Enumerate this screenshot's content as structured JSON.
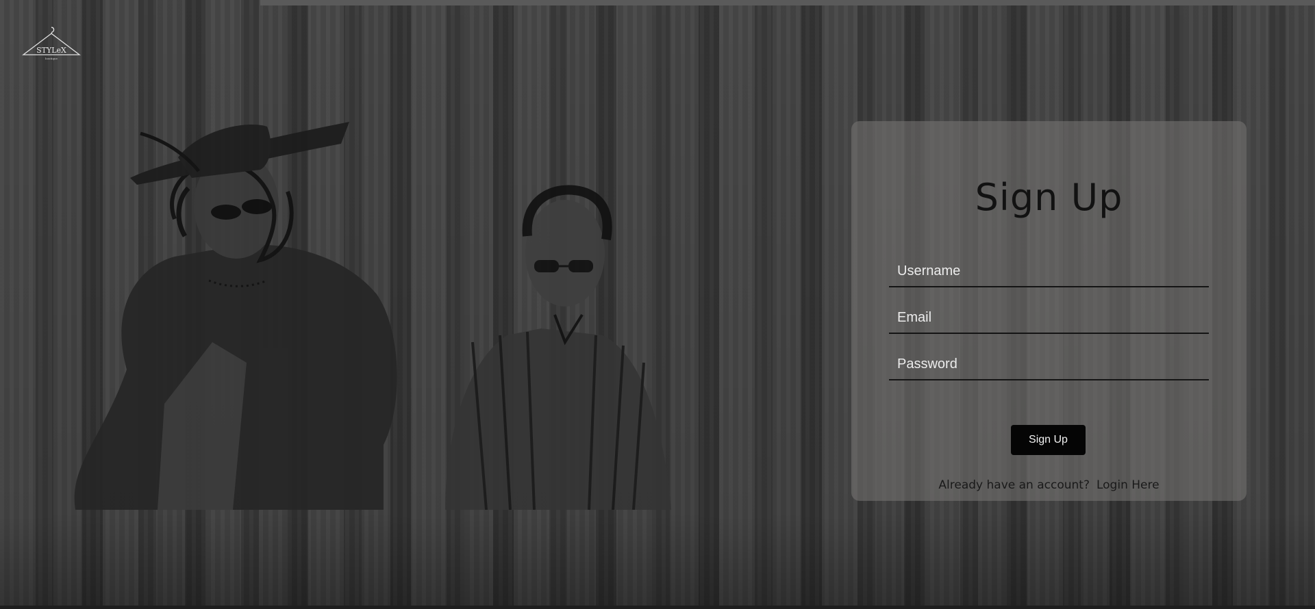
{
  "brand": {
    "logo_text": "STYLeX",
    "logo_subtext": "boutique"
  },
  "signup": {
    "title": "Sign Up",
    "username_placeholder": "Username",
    "email_placeholder": "Email",
    "password_placeholder": "Password",
    "submit_label": "Sign Up",
    "account_prompt": "Already have an account?",
    "login_link_label": "Login Here"
  }
}
